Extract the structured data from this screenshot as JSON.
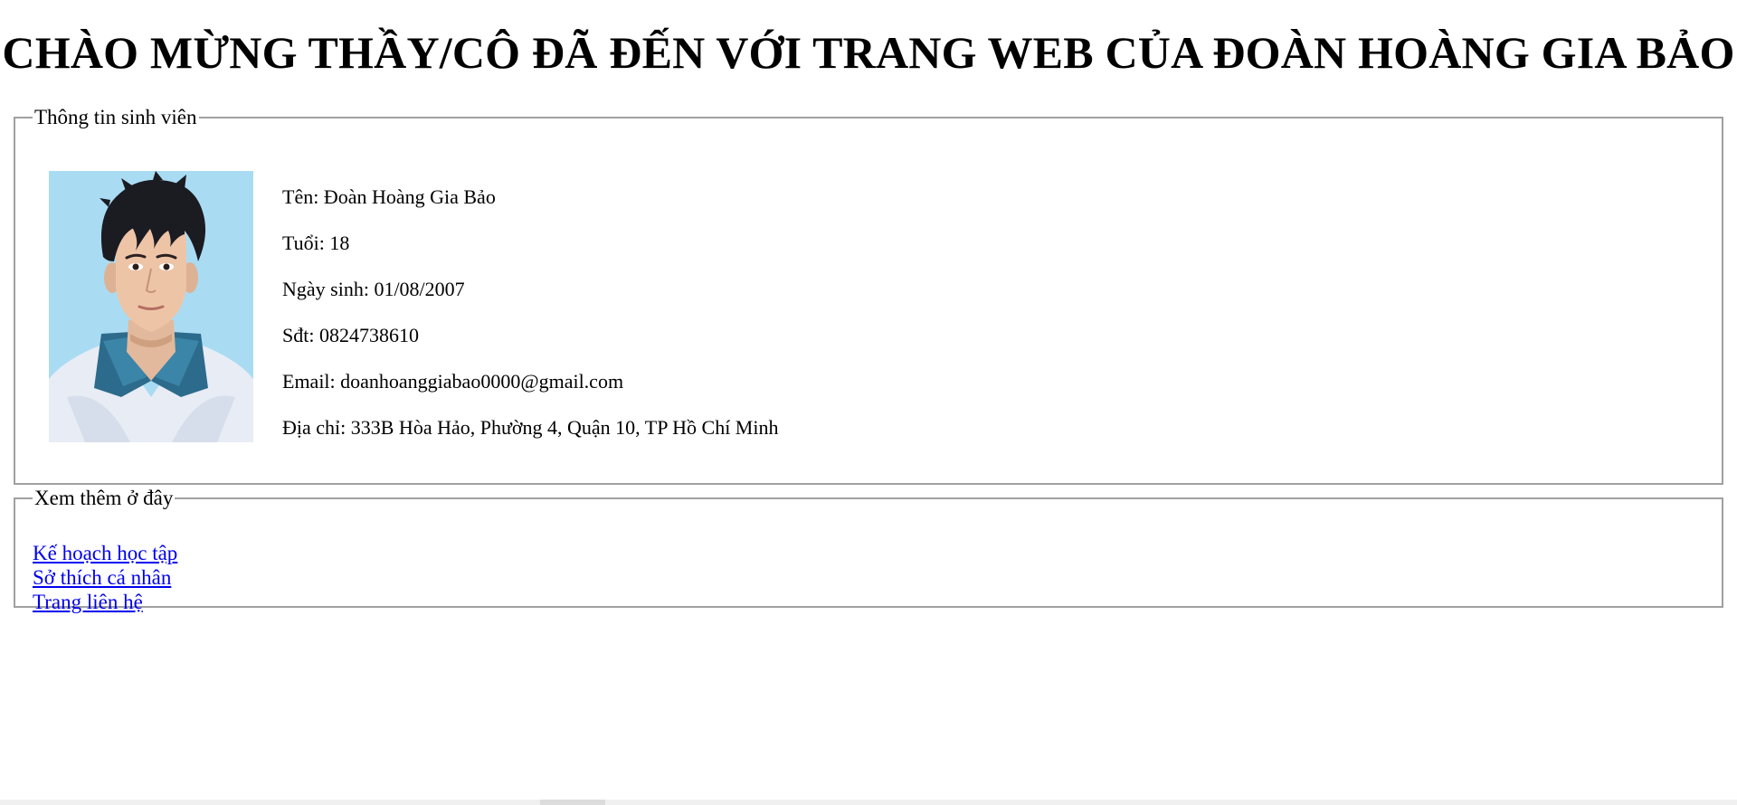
{
  "header": {
    "title": "CHÀO MỪNG THẦY/CÔ ĐÃ ĐẾN VỚI TRANG WEB CỦA ĐOÀN HOÀNG GIA BẢO"
  },
  "student_info": {
    "legend": "Thông tin sinh viên",
    "photo": "student-portrait",
    "name": "Tên: Đoàn Hoàng Gia Bảo",
    "age": "Tuổi: 18",
    "birthday": "Ngày sinh: 01/08/2007",
    "phone": "Sđt: 0824738610",
    "email": "Email: doanhoanggiabao0000@gmail.com",
    "address": "Địa chỉ: 333B Hòa Hảo, Phường 4, Quận 10, TP Hồ Chí Minh"
  },
  "more_links": {
    "legend": "Xem thêm ở đây",
    "items": [
      {
        "label": "Kế hoạch học tập"
      },
      {
        "label": "Sở thích cá nhân"
      },
      {
        "label": "Trang liên hệ"
      }
    ]
  },
  "colors": {
    "link": "#0000ee",
    "fieldset_border": "#a0a0a0",
    "photo_background": "#a9dcf3"
  }
}
